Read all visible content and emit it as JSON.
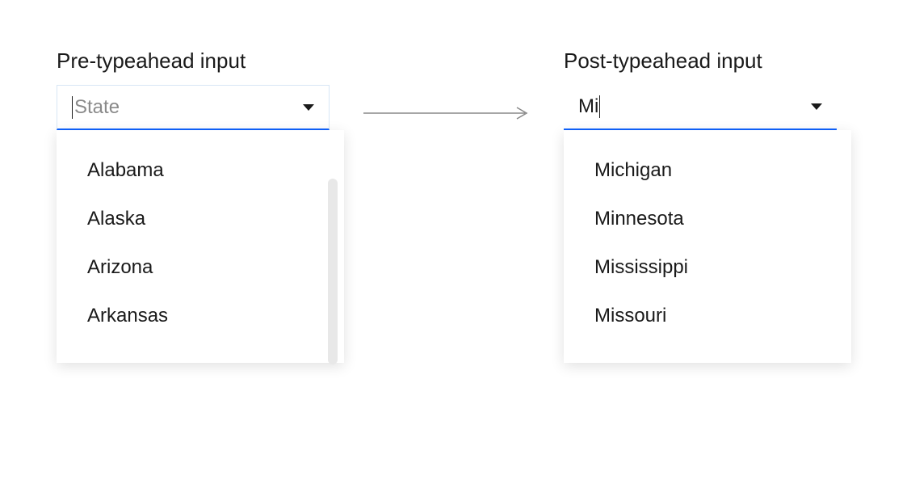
{
  "left": {
    "heading": "Pre-typeahead input",
    "placeholder": "State",
    "value": "",
    "options": [
      "Alabama",
      "Alaska",
      "Arizona",
      "Arkansas"
    ]
  },
  "right": {
    "heading": "Post-typeahead input",
    "value": "Mi",
    "options": [
      "Michigan",
      "Minnesota",
      "Mississippi",
      "Missouri"
    ]
  },
  "colors": {
    "accent": "#0f62fe",
    "placeholder": "#8a8a8a",
    "text": "#1a1a1a"
  }
}
